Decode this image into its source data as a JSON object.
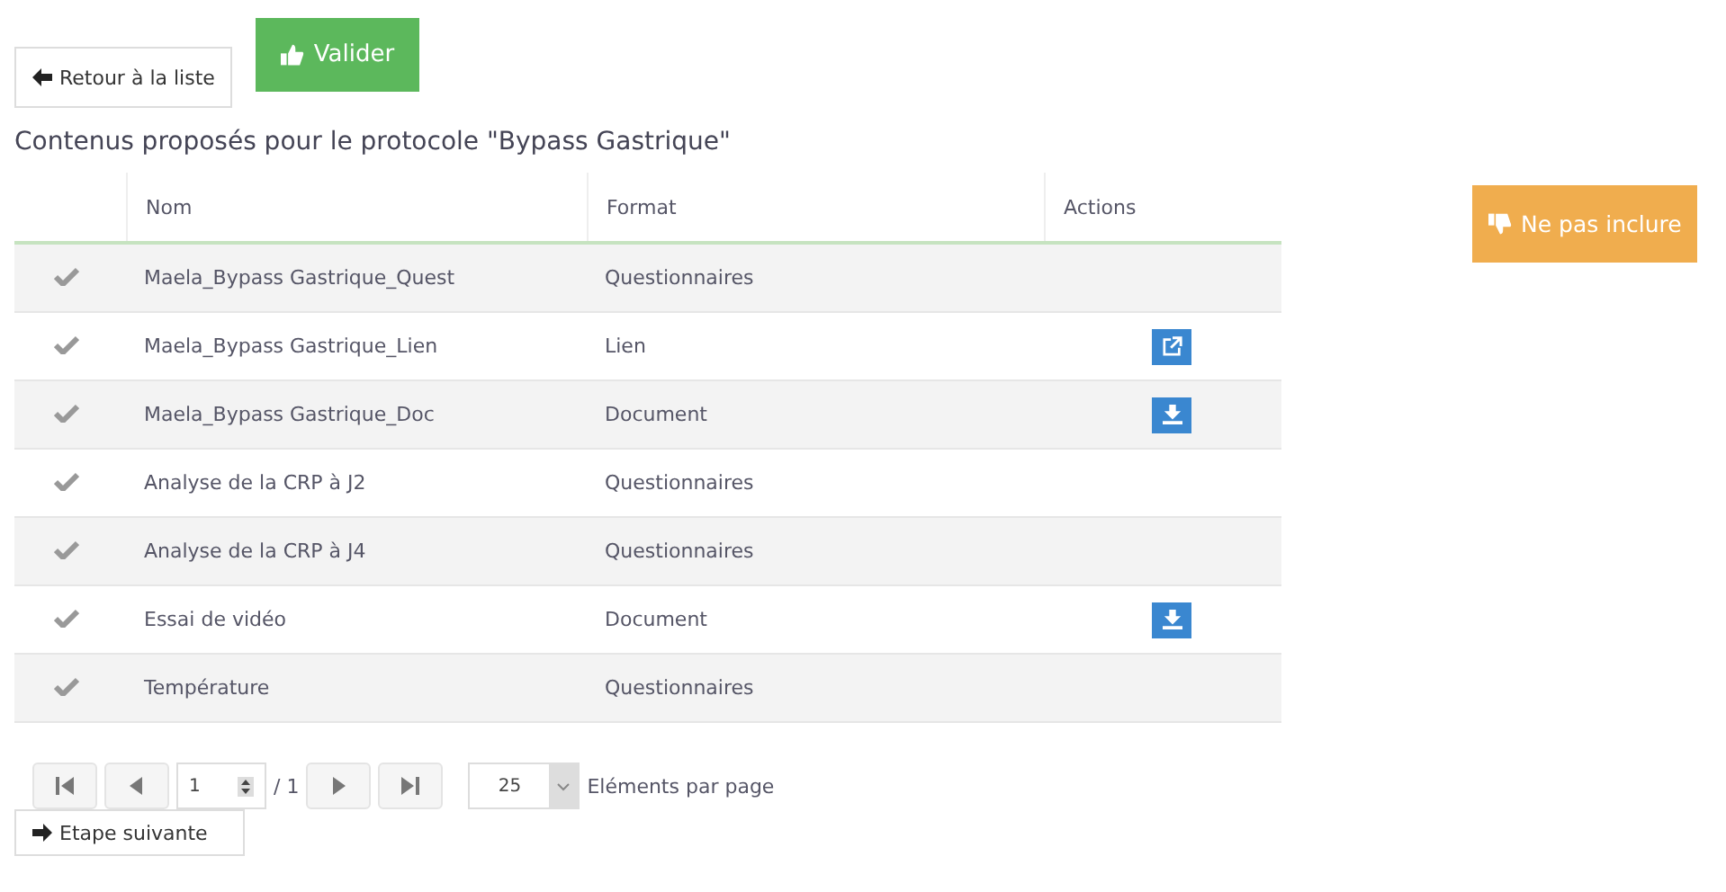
{
  "toolbar": {
    "back_button": "Retour à la liste",
    "validate_button": "Valider"
  },
  "exclude_button": "Ne pas inclure",
  "title": "Contenus proposés pour le protocole \"Bypass Gastrique\"",
  "table": {
    "columns": [
      "Nom",
      "Format",
      "Actions"
    ],
    "rows": [
      {
        "name": "Maela_Bypass Gastrique_Quest",
        "format": "Questionnaires"
      },
      {
        "name": "Maela_Bypass Gastrique_Lien",
        "format": "Lien",
        "actions": [
          {
            "kind": "link"
          }
        ]
      },
      {
        "name": "Maela_Bypass Gastrique_Doc",
        "format": "Document",
        "actions": [
          {
            "kind": "download"
          }
        ]
      },
      {
        "name": "Analyse de la CRP à J2",
        "format": "Questionnaires"
      },
      {
        "name": "Analyse de la CRP à J4",
        "format": "Questionnaires"
      },
      {
        "name": "Essai de vidéo",
        "format": "Document",
        "actions": [
          {
            "kind": "download"
          }
        ]
      },
      {
        "name": "Température",
        "format": "Questionnaires"
      }
    ]
  },
  "pagination": {
    "page": "1",
    "total": "/ 1",
    "page_size": "25",
    "page_size_label": "Eléments par page"
  },
  "next_button": "Etape suivante"
}
